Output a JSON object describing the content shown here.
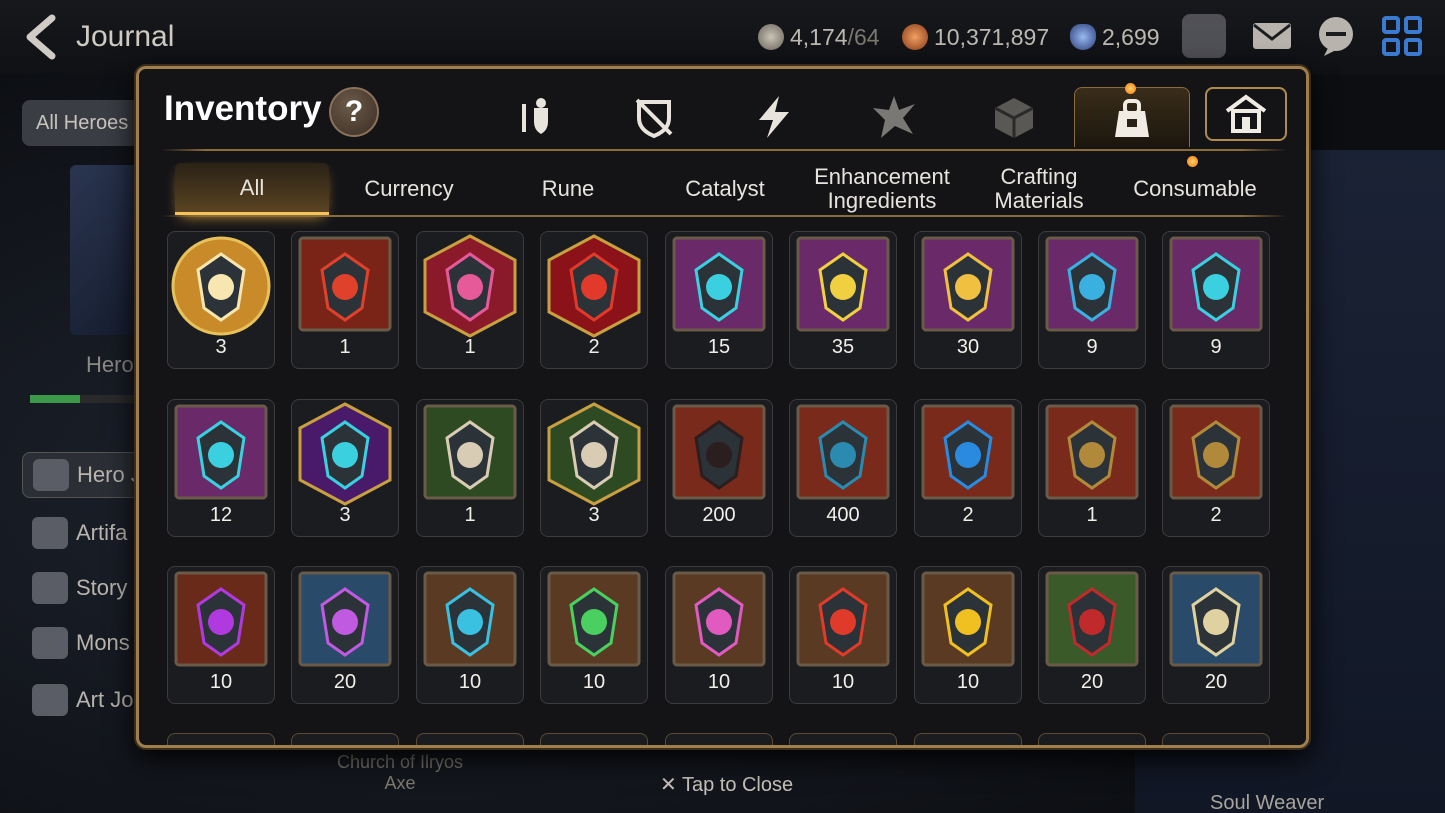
{
  "topbar": {
    "title": "Journal",
    "resources": [
      {
        "icon": "stamina-icon",
        "value": "4,174",
        "sub": "/64"
      },
      {
        "icon": "gold-icon",
        "value": "10,371,897",
        "sub": ""
      },
      {
        "icon": "skystone-icon",
        "value": "2,699",
        "sub": ""
      }
    ]
  },
  "background": {
    "all_heroes": "All Heroes",
    "heroes_label": "Hero",
    "side_items": [
      "Hero J",
      "Artifa",
      "Story",
      "Mons",
      "Art Jo"
    ],
    "church_label": "Church of Ilryos",
    "church_sub": "Axe",
    "soul_weaver": "Soul Weaver",
    "tap_close": "✕ Tap to Close"
  },
  "modal": {
    "title": "Inventory",
    "help": "?",
    "categories": [
      "hero-gear-icon",
      "unequip-gear-icon",
      "lightning-icon",
      "artifact-icon",
      "cube-icon",
      "bag-icon",
      "house-icon"
    ],
    "tabs": [
      "All",
      "Currency",
      "Rune",
      "Catalyst",
      "Enhancement\nIngredients",
      "Crafting\nMaterials",
      "Consumable"
    ],
    "active_tab": "All"
  },
  "items": [
    {
      "icon": "chick-icon",
      "qty": "3",
      "shape": "circle",
      "bg": "#c98a2a",
      "fg": "#f7e6b0"
    },
    {
      "icon": "red-potion-icon",
      "qty": "1",
      "shape": "square",
      "bg": "#7a2418",
      "fg": "#e0412a"
    },
    {
      "icon": "pink-potion-icon",
      "qty": "1",
      "shape": "hex",
      "bg": "#8a1a2a",
      "fg": "#e65a9a"
    },
    {
      "icon": "red-crystal-icon",
      "qty": "2",
      "shape": "hex",
      "bg": "#8a1218",
      "fg": "#e23a2a"
    },
    {
      "icon": "sword-rune-icon",
      "qty": "15",
      "shape": "square",
      "bg": "#6a2a6a",
      "fg": "#3ad0e0"
    },
    {
      "icon": "bolt-rune-icon",
      "qty": "35",
      "shape": "square",
      "bg": "#6a2a6a",
      "fg": "#f0d040"
    },
    {
      "icon": "hammer-rune-icon",
      "qty": "30",
      "shape": "square",
      "bg": "#6a2a6a",
      "fg": "#f0c040"
    },
    {
      "icon": "swirl-rune-icon",
      "qty": "9",
      "shape": "square",
      "bg": "#6a2a6a",
      "fg": "#3ab0e0"
    },
    {
      "icon": "boot-rune-icon",
      "qty": "9",
      "shape": "square",
      "bg": "#6a2a6a",
      "fg": "#3ad0e0"
    },
    {
      "icon": "scroll-rune-icon",
      "qty": "12",
      "shape": "square",
      "bg": "#6a2a6a",
      "fg": "#3ad0e0"
    },
    {
      "icon": "star-rune-icon",
      "qty": "3",
      "shape": "hex",
      "bg": "#4a1a6a",
      "fg": "#3ad0e0"
    },
    {
      "icon": "sword-stone-icon",
      "qty": "1",
      "shape": "square",
      "bg": "#2e4a22",
      "fg": "#d8cdb4"
    },
    {
      "icon": "star-stone-icon",
      "qty": "3",
      "shape": "hex",
      "bg": "#2e4a22",
      "fg": "#d8cdb4"
    },
    {
      "icon": "ember-crystal-icon",
      "qty": "200",
      "shape": "square",
      "bg": "#7a2a1a",
      "fg": "#2a1e1e"
    },
    {
      "icon": "blue-shard-icon",
      "qty": "400",
      "shape": "square",
      "bg": "#7a2a1a",
      "fg": "#2a8ab0"
    },
    {
      "icon": "blue-chest-icon",
      "qty": "2",
      "shape": "square",
      "bg": "#7a2a1a",
      "fg": "#2a8ae0"
    },
    {
      "icon": "gold-chest-icon",
      "qty": "1",
      "shape": "square",
      "bg": "#7a2a1a",
      "fg": "#b08a3a"
    },
    {
      "icon": "gold-chest-icon",
      "qty": "2",
      "shape": "square",
      "bg": "#7a2a1a",
      "fg": "#b08a3a"
    },
    {
      "icon": "purple-moon-gem-icon",
      "qty": "10",
      "shape": "square",
      "bg": "#6a2a1a",
      "fg": "#b03ae0"
    },
    {
      "icon": "purple-shard-icon",
      "qty": "20",
      "shape": "square",
      "bg": "#2a4a6a",
      "fg": "#c05ae0"
    },
    {
      "icon": "blue-orb-icon",
      "qty": "10",
      "shape": "square",
      "bg": "#5a3a22",
      "fg": "#3ac0e0"
    },
    {
      "icon": "green-orb-icon",
      "qty": "10",
      "shape": "square",
      "bg": "#5a3a22",
      "fg": "#4ad060"
    },
    {
      "icon": "pink-orb-icon",
      "qty": "10",
      "shape": "square",
      "bg": "#5a3a22",
      "fg": "#e05ac0"
    },
    {
      "icon": "red-orb-icon",
      "qty": "10",
      "shape": "square",
      "bg": "#5a3a22",
      "fg": "#e03a2a"
    },
    {
      "icon": "yellow-orb-icon",
      "qty": "10",
      "shape": "square",
      "bg": "#5a3a22",
      "fg": "#f0c020"
    },
    {
      "icon": "claw-icon",
      "qty": "20",
      "shape": "square",
      "bg": "#3a5a2a",
      "fg": "#c02a2a"
    },
    {
      "icon": "herb-icon",
      "qty": "20",
      "shape": "square",
      "bg": "#2a4a6a",
      "fg": "#e0d2a0"
    }
  ]
}
